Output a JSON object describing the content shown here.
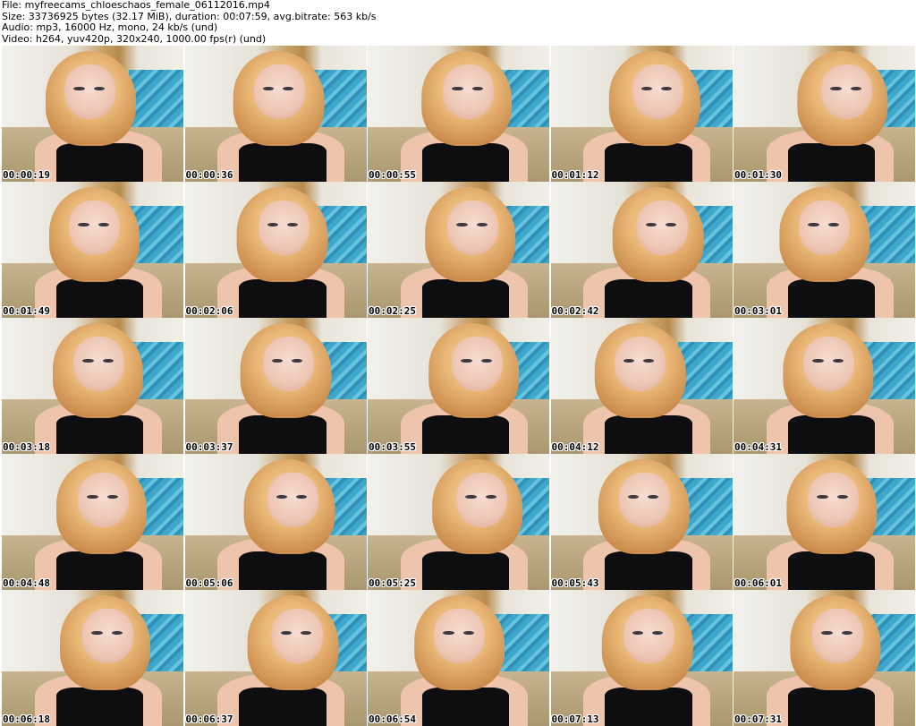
{
  "header": {
    "file": "File: myfreecams_chloeschaos_female_06112016.mp4",
    "size": "Size: 33736925 bytes (32.17 MiB), duration: 00:07:59, avg.bitrate: 563 kb/s",
    "audio": "Audio: mp3, 16000 Hz, mono, 24 kb/s (und)",
    "video": "Video: h264, yuv420p, 320x240, 1000.00 fps(r) (und)"
  },
  "thumbnails": [
    {
      "timestamp": "00:00:19"
    },
    {
      "timestamp": "00:00:36"
    },
    {
      "timestamp": "00:00:55"
    },
    {
      "timestamp": "00:01:12"
    },
    {
      "timestamp": "00:01:30"
    },
    {
      "timestamp": "00:01:49"
    },
    {
      "timestamp": "00:02:06"
    },
    {
      "timestamp": "00:02:25"
    },
    {
      "timestamp": "00:02:42"
    },
    {
      "timestamp": "00:03:01"
    },
    {
      "timestamp": "00:03:18"
    },
    {
      "timestamp": "00:03:37"
    },
    {
      "timestamp": "00:03:55"
    },
    {
      "timestamp": "00:04:12"
    },
    {
      "timestamp": "00:04:31"
    },
    {
      "timestamp": "00:04:48"
    },
    {
      "timestamp": "00:05:06"
    },
    {
      "timestamp": "00:05:25"
    },
    {
      "timestamp": "00:05:43"
    },
    {
      "timestamp": "00:06:01"
    },
    {
      "timestamp": "00:06:18"
    },
    {
      "timestamp": "00:06:37"
    },
    {
      "timestamp": "00:06:54"
    },
    {
      "timestamp": "00:07:13"
    },
    {
      "timestamp": "00:07:31"
    }
  ]
}
